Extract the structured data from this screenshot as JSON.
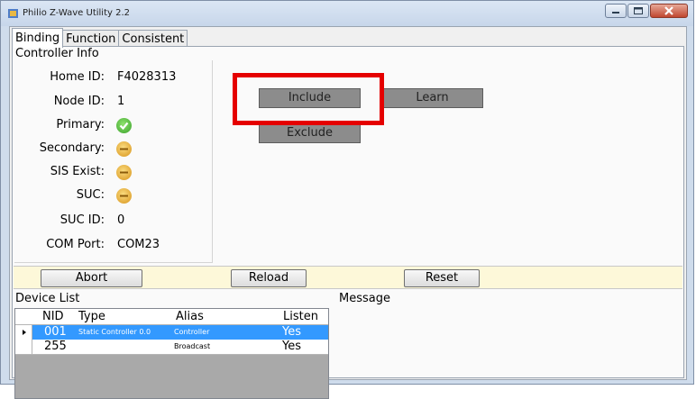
{
  "window": {
    "title": "Philio Z-Wave Utility 2.2"
  },
  "tabs": [
    {
      "label": "Binding"
    },
    {
      "label": "Function"
    },
    {
      "label": "Consistent"
    }
  ],
  "controller_info": {
    "title": "Controller Info",
    "home_id_label": "Home ID:",
    "home_id": "F4028313",
    "node_id_label": "Node ID:",
    "node_id": "1",
    "primary_label": "Primary:",
    "secondary_label": "Secondary:",
    "sis_label": "SIS Exist:",
    "suc_label": "SUC:",
    "suc_id_label": "SUC ID:",
    "suc_id": "0",
    "com_port_label": "COM Port:",
    "com_port": "COM23"
  },
  "status_icons": {
    "primary": "check-icon",
    "secondary": "warning-icon",
    "sis": "warning-icon",
    "suc": "warning-icon"
  },
  "actions": {
    "include": "Include",
    "learn": "Learn",
    "exclude": "Exclude"
  },
  "toolbar": {
    "abort": "Abort",
    "reload": "Reload",
    "reset": "Reset"
  },
  "device_list": {
    "title": "Device List",
    "columns": [
      "NID",
      "Type",
      "Alias",
      "Listen"
    ],
    "rows": [
      {
        "nid": "001",
        "type": "Static Controller  0.0",
        "alias": "Controller",
        "listen": "Yes",
        "selected": true
      },
      {
        "nid": "255",
        "type": "",
        "alias": "Broadcast",
        "listen": "Yes",
        "selected": false
      }
    ]
  },
  "message": {
    "title": "Message"
  },
  "colors": {
    "selection": "#3399ff",
    "highlight_box": "#e50000",
    "action_bar": "#fdf8d9"
  }
}
